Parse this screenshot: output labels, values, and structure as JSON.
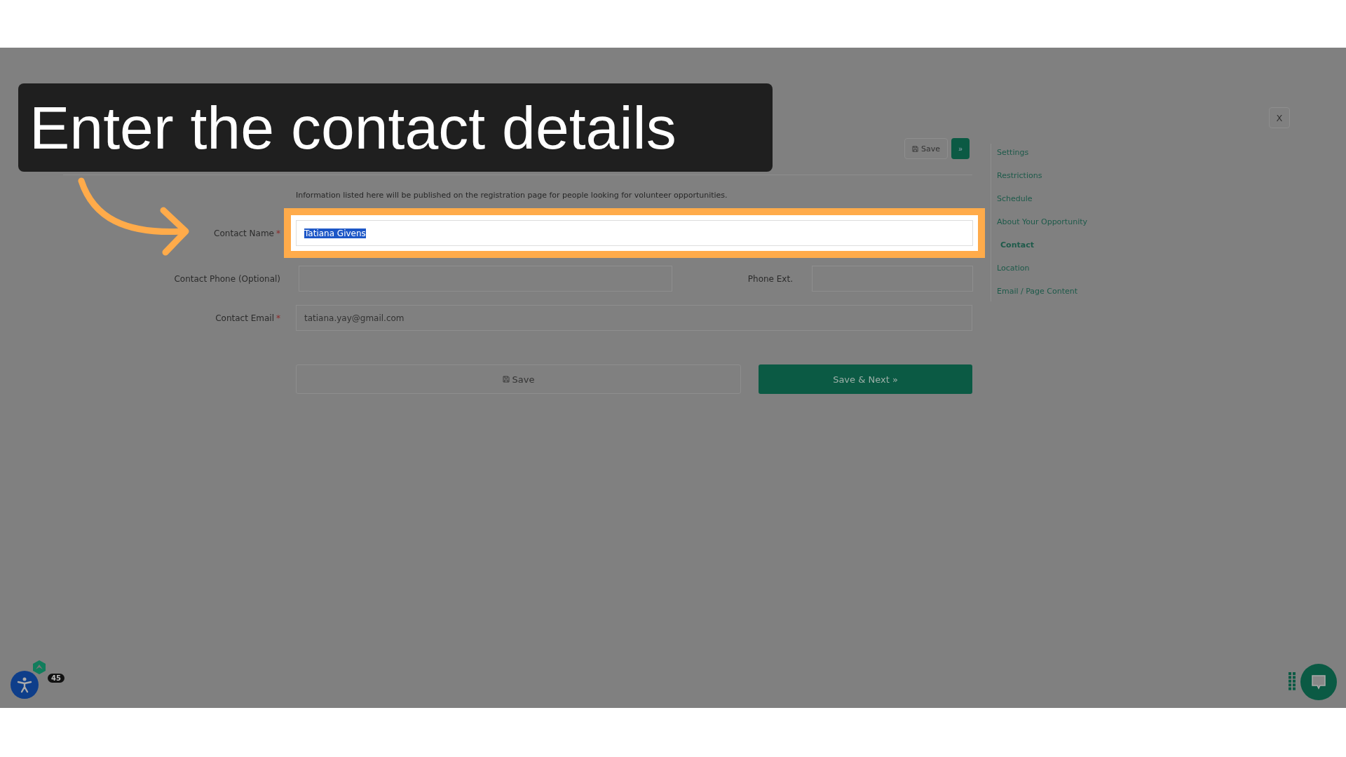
{
  "caption": "Enter the contact details",
  "close": "X",
  "toolbar": {
    "save": "Save",
    "next": "»"
  },
  "info": "Information listed here will be published on the registration page for people looking for volunteer opportunities.",
  "fields": [
    {
      "kind": "single",
      "label": "Contact Name",
      "required_mark": "*",
      "value": "Tatiana  Givens",
      "highlighted": true,
      "text_selected": true
    },
    {
      "kind": "pair",
      "label": "Contact Phone (Optional)",
      "second_label": "Phone Ext."
    },
    {
      "kind": "single",
      "label": "Contact Email",
      "required_mark": "*",
      "value": "tatiana.yay@gmail.com",
      "highlighted": false,
      "text_selected": false
    }
  ],
  "buttons": {
    "save": "Save",
    "save_next": "Save & Next »"
  },
  "sidebar": {
    "items": [
      {
        "label": "Settings",
        "selected": false
      },
      {
        "label": "Restrictions",
        "selected": false
      },
      {
        "label": "Schedule",
        "selected": false
      },
      {
        "label": "About Your Opportunity",
        "selected": false
      },
      {
        "label": "Contact",
        "selected": true
      },
      {
        "label": "Location",
        "selected": false
      },
      {
        "label": "Email / Page Content",
        "selected": false
      }
    ]
  },
  "badge": "45"
}
